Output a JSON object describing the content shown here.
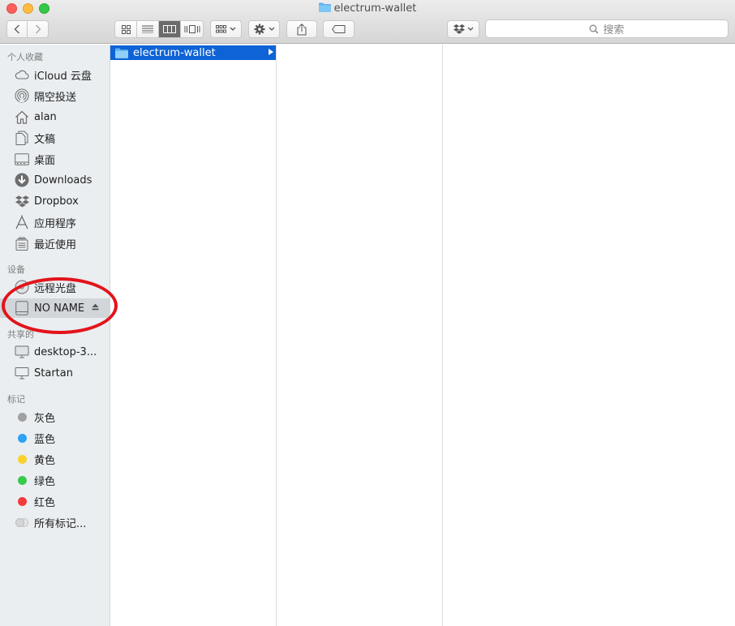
{
  "window": {
    "title": "electrum-wallet"
  },
  "toolbar": {
    "back_icon": "chevron-left-icon",
    "forward_icon": "chevron-right-icon",
    "views": [
      "icon-view",
      "list-view",
      "column-view",
      "cover-flow-view"
    ],
    "active_view": "column-view",
    "search_placeholder": "搜索"
  },
  "sidebar": {
    "favorites_header": "个人收藏",
    "favorites": [
      {
        "label": "iCloud 云盘",
        "icon": "cloud-icon"
      },
      {
        "label": "隔空投送",
        "icon": "airdrop-icon"
      },
      {
        "label": "alan",
        "icon": "home-icon"
      },
      {
        "label": "文稿",
        "icon": "documents-icon"
      },
      {
        "label": "桌面",
        "icon": "desktop-icon"
      },
      {
        "label": "Downloads",
        "icon": "download-icon"
      },
      {
        "label": "Dropbox",
        "icon": "dropbox-icon"
      },
      {
        "label": "应用程序",
        "icon": "applications-icon"
      },
      {
        "label": "最近使用",
        "icon": "recents-icon"
      }
    ],
    "devices_header": "设备",
    "devices": [
      {
        "label": "远程光盘",
        "icon": "disc-icon"
      },
      {
        "label": "NO NAME",
        "icon": "drive-icon",
        "selected": true
      }
    ],
    "shared_header": "共享的",
    "shared": [
      {
        "label": "desktop-3...",
        "icon": "monitor-icon"
      },
      {
        "label": "Startan",
        "icon": "display-icon"
      }
    ],
    "tags_header": "标记",
    "tags": [
      {
        "label": "灰色",
        "color": "#a0a0a0"
      },
      {
        "label": "蓝色",
        "color": "#2fa2f4"
      },
      {
        "label": "黄色",
        "color": "#fdd12e"
      },
      {
        "label": "绿色",
        "color": "#39c94a"
      },
      {
        "label": "红色",
        "color": "#f23c3c"
      },
      {
        "label": "所有标记...",
        "color": "#d5d5d5"
      }
    ]
  },
  "columns": [
    {
      "items": [
        {
          "label": "electrum-wallet",
          "icon": "folder-icon",
          "selected": true
        }
      ]
    },
    {
      "items": []
    },
    {
      "items": []
    }
  ],
  "colors": {
    "selection": "#0e63d6",
    "annotation": "#e2141a"
  }
}
